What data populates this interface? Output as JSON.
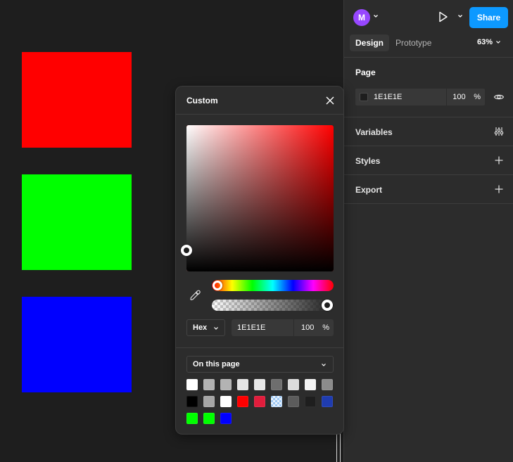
{
  "canvas": {
    "frames": [
      {
        "name": "red",
        "color": "#ff0000"
      },
      {
        "name": "green",
        "color": "#00ff00"
      },
      {
        "name": "blue",
        "color": "#0000ff"
      }
    ]
  },
  "header": {
    "avatar_initial": "M",
    "avatar_color": "#9747ff",
    "share_label": "Share",
    "accent_color": "#0d99ff",
    "play_icon": "play-icon"
  },
  "tabs": [
    {
      "label": "Design",
      "active": true
    },
    {
      "label": "Prototype",
      "active": false
    }
  ],
  "zoom_label": "63%",
  "sections": {
    "page": {
      "title": "Page",
      "fill_hex": "1E1E1E",
      "fill_opacity": "100",
      "percent_sign": "%",
      "fill_color": "#1e1e1e",
      "visibility_icon": "eye-icon"
    },
    "variables": {
      "title": "Variables",
      "icon": "adjust-icon"
    },
    "styles": {
      "title": "Styles",
      "icon": "plus-icon"
    },
    "export": {
      "title": "Export",
      "icon": "plus-icon"
    }
  },
  "picker": {
    "title": "Custom",
    "close_icon": "close-icon",
    "hue_color": "#ff0000",
    "hue_position": 0,
    "saturation": 0,
    "brightness": 0.12,
    "format": "Hex",
    "hex_value": "1E1E1E",
    "alpha_value": "100",
    "percent_sign": "%",
    "library_select": "On this page",
    "swatches": [
      "#ffffff",
      "#b3b3b3",
      "#b3b3b3",
      "#e6e6e6",
      "#e6e6e6",
      "#6e6e6e",
      "#dcdcdc",
      "#f2f2f2",
      "#8c8c8c",
      "#000000",
      "#a6a6a6",
      "#ffffff",
      "#ff0000",
      "#e11d3c",
      "checker",
      "#5c5c5c",
      "#1e1e1e",
      "#1f3cb0",
      "#00ff00",
      "#00ff00",
      "#0000ff"
    ]
  }
}
